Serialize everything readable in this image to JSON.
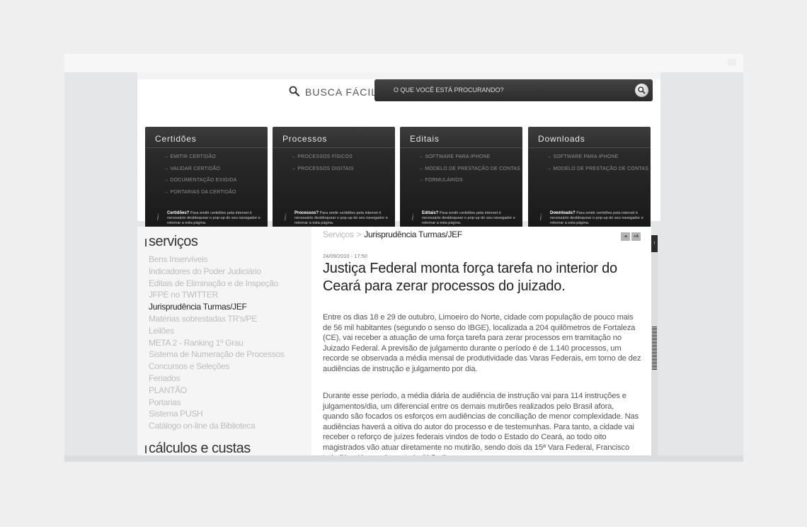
{
  "search": {
    "label": "BUSCA FÁCIL:",
    "placeholder": "O QUE VOCÊ ESTÁ PROCURANDO?"
  },
  "boxes": [
    {
      "title": "Certidões",
      "links": [
        "→ EMITIR CERTIDÃO",
        "→ VALIDAR CERTIDÃO",
        "→ DOCUMENTAÇÃO EXIGIDA",
        "→ PORTARIAS DA CERTIDÃO"
      ],
      "note_bold": "Certidões?",
      "note_text": "Para emitir certidões pela internet é necessário desbloquear o pop-up do seu navegador e retornar a esta página."
    },
    {
      "title": "Processos",
      "links": [
        "→ PROCESSOS FÍSICOS",
        "→ PROCESSOS DIGITAIS"
      ],
      "note_bold": "Processos?",
      "note_text": "Para emitir certidões pela internet é necessário desbloquear o pop-up do seu navegador e retornar a esta página."
    },
    {
      "title": "Editais",
      "links": [
        "→ SOFTWARE PARA IPHONE",
        "→ MODELO DE PRESTAÇÃO DE CONTAS",
        "→ FORMULÁRIOS"
      ],
      "note_bold": "Editais?",
      "note_text": "Para emitir certidões pela internet é necessário desbloquear o pop-up do seu navegador e retornar a esta página."
    },
    {
      "title": "Downloads",
      "links": [
        "→ SOFTWARE PARA IPHONE",
        "→ MODELO DE PRESTAÇÃO DE CONTAS"
      ],
      "note_bold": "Downloads?",
      "note_text": "Para emitir certidões pela internet é necessário desbloquear o pop-up do seu navegador e retornar a esta página."
    }
  ],
  "sidebar": {
    "section_title": "serviços",
    "items": [
      "Bens Inservíveis",
      "Indicadores do Poder Judiciário",
      "Editais de Eliminação e de Inspeção",
      "JFPE no TWITTER",
      "Jurisprudência Turmas/JEF",
      "Matérias sobrestadas TR's/PE",
      "Leilões",
      "META 2 - Ranking 1º Grau",
      "Sistema de Numeração de Processos",
      "Concursos e Seleções",
      "Feriados",
      "PLANTÃO",
      "Portarias",
      "Sistema PUSH",
      "Catálogo on-line da Biblioteca"
    ],
    "active_item": "Jurisprudência Turmas/JEF",
    "next_section_title": "cálculos e custas"
  },
  "breadcrumb": {
    "root": "Serviços",
    "separator": ">",
    "current": "Jurisprudência Turmas/JEF"
  },
  "font_controls": {
    "decrease": "-a",
    "increase": "+A"
  },
  "article": {
    "date": "24/09/2010 - 17:50",
    "title": "Justiça Federal monta força tarefa no interior do Ceará para zerar processos do juizado.",
    "paragraphs": [
      "Entre os dias 18 e 29 de outubro, Limoeiro do Norte, cidade com população de pouco mais de 56 mil habitantes (segundo o senso do IBGE), localizada a 204 quilômetros de Fortaleza (CE), vai receber a atuação de uma força tarefa para zerar processos em tramitação no Juizado Federal. A previsão de julgamento durante o período é de 1.140 processos, um recorde se observada a média mensal de produtividade das Varas Federais, em torno de dez audiências de instrução e julgamento por dia.",
      "Durante esse período, a média diária de audiência de instrução vai para 114 instruções e julgamentos/dia, um diferencial entre os demais mutirões realizados pelo Brasil afora, quando são focados os esforços em audiências de conciliação de menor complexidade. Nas audiências haverá a oitiva do autor do processo e de testemunhas. Para tanto, a cidade vai receber o reforço de juízes federais vindos de todo o Estado do Ceará, ao todo oito magistrados vão atuar diretamente no mutirão, sendo dois da 15ª Vara Federal, Francisco Luiz Rios Alves e Jorge Luis Girão Barreto."
    ]
  },
  "scrollbar": {
    "up_glyph": "↑"
  }
}
